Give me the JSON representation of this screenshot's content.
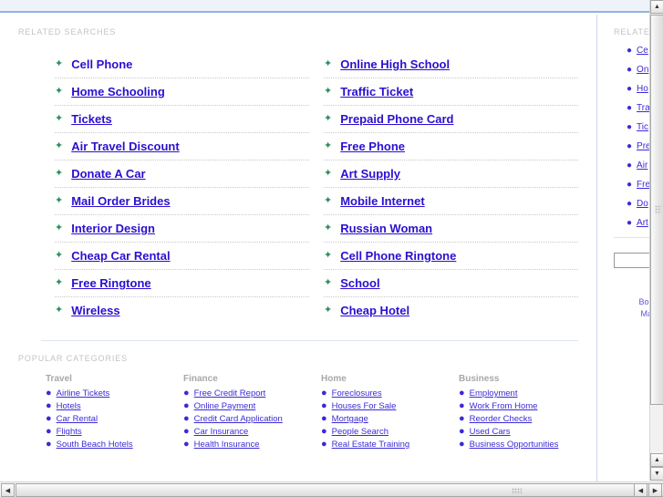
{
  "related": {
    "label": "RELATED SEARCHES",
    "arrow_icon": "✦",
    "items": [
      {
        "label": "Cell Phone",
        "underlined": false
      },
      {
        "label": "Online High School",
        "underlined": true
      },
      {
        "label": "Home Schooling",
        "underlined": true
      },
      {
        "label": "Traffic Ticket",
        "underlined": true
      },
      {
        "label": "Tickets",
        "underlined": true
      },
      {
        "label": "Prepaid Phone Card",
        "underlined": true
      },
      {
        "label": "Air Travel Discount",
        "underlined": true
      },
      {
        "label": "Free Phone",
        "underlined": true
      },
      {
        "label": "Donate A Car",
        "underlined": true
      },
      {
        "label": "Art Supply",
        "underlined": true
      },
      {
        "label": "Mail Order Brides",
        "underlined": true
      },
      {
        "label": "Mobile Internet",
        "underlined": true
      },
      {
        "label": "Interior Design",
        "underlined": true
      },
      {
        "label": "Russian Woman",
        "underlined": true
      },
      {
        "label": "Cheap Car Rental",
        "underlined": true
      },
      {
        "label": "Cell Phone Ringtone",
        "underlined": true
      },
      {
        "label": "Free Ringtone",
        "underlined": true
      },
      {
        "label": "School",
        "underlined": true
      },
      {
        "label": "Wireless",
        "underlined": true
      },
      {
        "label": "Cheap Hotel",
        "underlined": true
      }
    ]
  },
  "categories": {
    "label": "POPULAR CATEGORIES",
    "bullet_icon": "●",
    "groups": [
      {
        "title": "Travel",
        "links": [
          "Airline Tickets",
          "Hotels",
          "Car Rental",
          "Flights",
          "South Beach Hotels"
        ]
      },
      {
        "title": "Finance",
        "links": [
          "Free Credit Report",
          "Online Payment",
          "Credit Card Application",
          "Car Insurance",
          "Health Insurance"
        ]
      },
      {
        "title": "Home",
        "links": [
          "Foreclosures",
          "Houses For Sale",
          "Mortgage",
          "People Search",
          "Real Estate Training"
        ]
      },
      {
        "title": "Business",
        "links": [
          "Employment",
          "Work From Home",
          "Reorder Checks",
          "Used Cars",
          "Business Opportunities"
        ]
      }
    ]
  },
  "sidebar": {
    "label": "RELATED",
    "bullet_icon": "●",
    "items": [
      "Ce",
      "On",
      "Ho",
      "Tra",
      "Tic",
      "Pre",
      "Air",
      "Fre",
      "Do",
      "Art"
    ],
    "search_value": "",
    "search_placeholder": "",
    "actions": [
      "Bookmark",
      "Make this"
    ]
  },
  "scrollbars": {
    "up_arrow": "▲",
    "down_arrow": "▼",
    "left_arrow": "◀",
    "right_arrow": "▶"
  },
  "colors": {
    "link_blue": "#2a10d0",
    "arrow_green": "#2f8f5b",
    "label_gray": "#c3c3c3",
    "header_blue": "#8fb3de",
    "header_bg": "#eef3f9"
  }
}
